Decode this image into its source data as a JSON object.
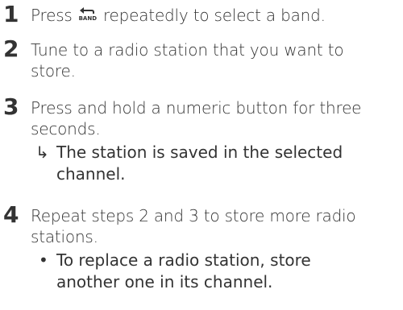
{
  "steps": [
    {
      "number": "1",
      "text_before_icon": "Press ",
      "icon": {
        "name": "band-return-icon",
        "label": "BAND"
      },
      "text_after_icon": " repeatedly to select a band."
    },
    {
      "number": "2",
      "line1": "Tune to a radio station that you want to",
      "line2": "store."
    },
    {
      "number": "3",
      "line1": "Press and hold a numeric button for three",
      "line2": "seconds.",
      "result_marker": "↳",
      "result_line1": "The station is saved in the selected",
      "result_line2": "channel."
    },
    {
      "number": "4",
      "line1": "Repeat steps 2 and 3 to store more radio",
      "line2": "stations.",
      "note_marker": "•",
      "note_line1": "To replace a radio station, store",
      "note_line2": "another one in its channel."
    }
  ]
}
